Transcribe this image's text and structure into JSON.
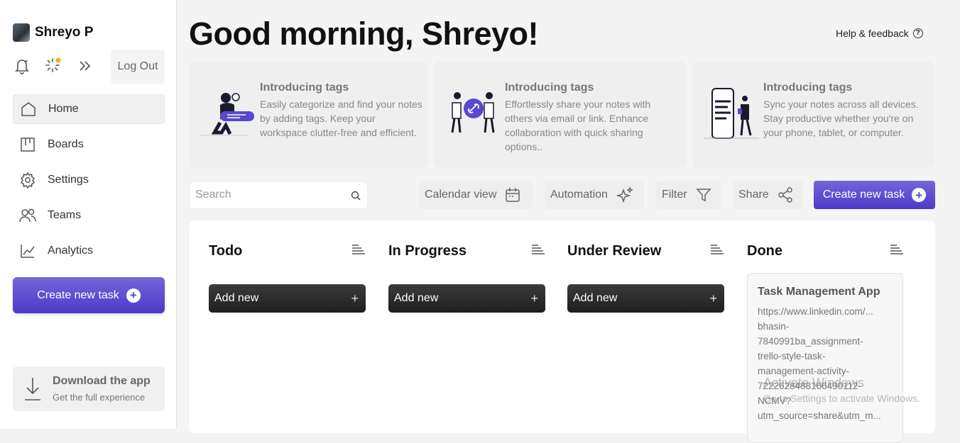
{
  "sidebar": {
    "user_name": "Shreyo P",
    "logout_label": "Log Out",
    "nav": [
      {
        "label": "Home",
        "icon": "home-icon"
      },
      {
        "label": "Boards",
        "icon": "boards-icon"
      },
      {
        "label": "Settings",
        "icon": "gear-icon"
      },
      {
        "label": "Teams",
        "icon": "teams-icon"
      },
      {
        "label": "Analytics",
        "icon": "analytics-icon"
      }
    ],
    "create_label": "Create new task",
    "download": {
      "title": "Download the app",
      "subtitle": "Get the full experience"
    }
  },
  "header": {
    "greeting": "Good morning, Shreyo!",
    "help_label": "Help & feedback"
  },
  "promos": [
    {
      "title": "Introducing tags",
      "body": "Easily categorize and find your notes by adding tags. Keep your workspace clutter-free and efficient."
    },
    {
      "title": "Introducing tags",
      "body": "Effortlessly share your notes with others via email or link. Enhance collaboration with quick sharing options.."
    },
    {
      "title": "Introducing tags",
      "body": "Sync your notes across all devices. Stay productive whether you're on your phone, tablet, or computer."
    }
  ],
  "toolbar": {
    "search_placeholder": "Search",
    "calendar_label": "Calendar view",
    "automation_label": "Automation",
    "filter_label": "Filter",
    "share_label": "Share",
    "create_label": "Create new task"
  },
  "columns": [
    {
      "title": "Todo",
      "add_label": "Add new"
    },
    {
      "title": "In Progress",
      "add_label": "Add new"
    },
    {
      "title": "Under Review",
      "add_label": "Add new"
    },
    {
      "title": "Done"
    }
  ],
  "card": {
    "title": "Task Management App",
    "lines": [
      "https://www.linkedin.com/...",
      "bhasin-",
      "7840991ba_assignment-",
      "trello-style-task-",
      "management-activity-",
      "7222628488166490112-",
      "NCMV?",
      "utm_source=share&utm_m..."
    ]
  },
  "watermark": {
    "title": "Activate Windows",
    "subtitle": "Go to Settings to activate Windows."
  },
  "colors": {
    "accent": "#5a48cf",
    "dark_button": "#2a2a2a"
  }
}
